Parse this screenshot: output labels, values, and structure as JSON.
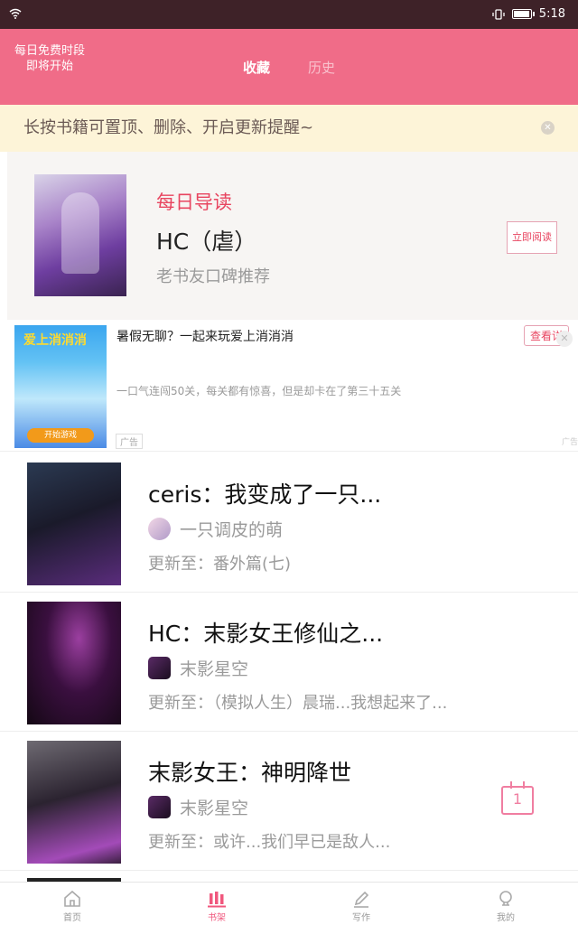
{
  "status": {
    "time": "5:18"
  },
  "header": {
    "free_line1": "每日免费时段",
    "free_line2": "即将开始",
    "tabs": [
      {
        "label": "收藏",
        "active": true
      },
      {
        "label": "历史",
        "active": false
      }
    ]
  },
  "notice": {
    "text": "长按书籍可置顶、删除、开启更新提醒~"
  },
  "daily": {
    "label": "每日导读",
    "title": "HC（虐）",
    "subtitle": "老书友口碑推荐",
    "button": "立即阅读"
  },
  "ad": {
    "headline": "暑假无聊？一起来玩爱上消消消",
    "description": "一口气连闯50关，每关都有惊喜，但是却卡在了第三十五关",
    "tag": "广告",
    "detail_button": "查看详",
    "thumb_title": "爱上消消消",
    "thumb_button": "开始游戏",
    "mark": "广告"
  },
  "books": [
    {
      "title": "ceris：我变成了一只...",
      "author": "一只调皮的萌",
      "update": "更新至：番外篇(七)",
      "cover_colors": [
        "#1a2a3a",
        "#5a2c7c"
      ]
    },
    {
      "title": "HC：末影女王修仙之...",
      "author": "末影星空",
      "update": "更新至：（模拟人生）晨瑞...我想起来了...",
      "cover_colors": [
        "#1a0d1f",
        "#6b1f6e"
      ]
    },
    {
      "title": "末影女王：神明降世",
      "author": "末影星空",
      "update": "更新至：或许...我们早已是敌人...",
      "cover_colors": [
        "#2b2330",
        "#a34bb8"
      ]
    }
  ],
  "calendar_icon": {
    "day": "1"
  },
  "tabbar": [
    {
      "label": "首页",
      "icon": "home-icon",
      "active": false
    },
    {
      "label": "书架",
      "icon": "bookshelf-icon",
      "active": true
    },
    {
      "label": "写作",
      "icon": "pen-icon",
      "active": false
    },
    {
      "label": "我的",
      "icon": "user-icon",
      "active": false
    }
  ],
  "colors": {
    "accent": "#f06c88",
    "status_bar": "#3e2228",
    "notice_bg": "#fdf4d8"
  }
}
